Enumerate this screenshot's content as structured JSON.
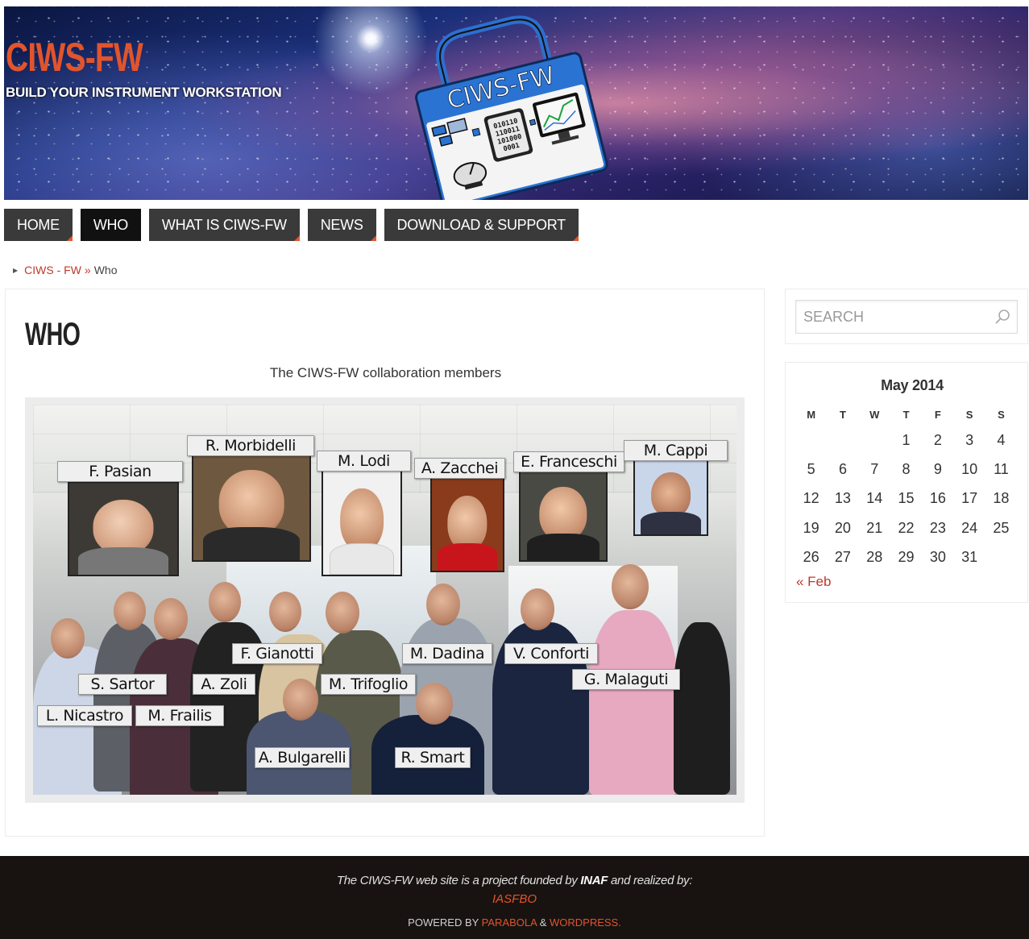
{
  "header": {
    "site_title": "CIWS-FW",
    "tagline": "BUILD YOUR INSTRUMENT WORKSTATION",
    "logo_text": "CIWS-FW",
    "logo_code_lines": [
      "010110",
      "110011",
      "101000",
      "0001"
    ]
  },
  "nav": {
    "items": [
      {
        "label": "HOME",
        "active": false
      },
      {
        "label": "WHO",
        "active": true
      },
      {
        "label": "WHAT IS CIWS-FW",
        "active": false
      },
      {
        "label": "NEWS",
        "active": false
      },
      {
        "label": "DOWNLOAD & SUPPORT",
        "active": false
      }
    ]
  },
  "breadcrumb": {
    "home": "CIWS - FW",
    "separator": "»",
    "current": "Who"
  },
  "main": {
    "title": "WHO",
    "caption": "The CIWS-FW collaboration members",
    "photo_labels": {
      "pasian": "F. Pasian",
      "morbidelli": "R. Morbidelli",
      "lodi": "M. Lodi",
      "zacchei": "A. Zacchei",
      "franceschi": "E. Franceschi",
      "cappi": "M. Cappi",
      "gianotti": "F. Gianotti",
      "dadina": "M. Dadina",
      "conforti": "V. Conforti",
      "sartor": "S. Sartor",
      "zoli": "A. Zoli",
      "trifoglio": "M. Trifoglio",
      "malaguti": "G. Malaguti",
      "nicastro": "L. Nicastro",
      "frailis": "M. Frailis",
      "bulgarelli": "A. Bulgarelli",
      "smart": "R. Smart"
    }
  },
  "sidebar": {
    "search": {
      "placeholder": "SEARCH"
    },
    "calendar": {
      "caption": "May 2014",
      "weekdays": [
        "M",
        "T",
        "W",
        "T",
        "F",
        "S",
        "S"
      ],
      "weeks": [
        [
          "",
          "",
          "",
          "1",
          "2",
          "3",
          "4"
        ],
        [
          "5",
          "6",
          "7",
          "8",
          "9",
          "10",
          "11"
        ],
        [
          "12",
          "13",
          "14",
          "15",
          "16",
          "17",
          "18"
        ],
        [
          "19",
          "20",
          "21",
          "22",
          "23",
          "24",
          "25"
        ],
        [
          "26",
          "27",
          "28",
          "29",
          "30",
          "31",
          ""
        ]
      ],
      "prev_link": "« Feb"
    }
  },
  "footer": {
    "line_pre": "The CIWS-FW web site is a project founded by ",
    "org": "INAF",
    "line_post": " and realized by:",
    "realizer": "IASFBO",
    "powered_by": "POWERED BY ",
    "theme": "PARABOLA",
    "amp": " & ",
    "wordpress": "WORDPRESS."
  },
  "colors": {
    "accent": "#e2542c",
    "link": "#c0392b",
    "nav_bg": "#3a3a3a",
    "nav_active_bg": "#111111",
    "footer_bg": "#181311"
  }
}
